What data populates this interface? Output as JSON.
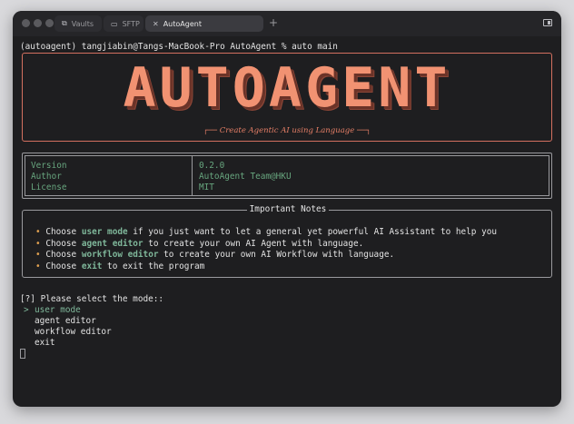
{
  "tabs": [
    {
      "label": "Vaults",
      "icon": "vault-icon"
    },
    {
      "label": "SFTP",
      "icon": "folder-icon"
    },
    {
      "label": "AutoAgent",
      "icon": "close-icon"
    }
  ],
  "prompt": "(autoagent) tangjiabin@Tangs-MacBook-Pro AutoAgent % auto main",
  "banner": {
    "logo": "AUTOAGENT",
    "tagline": "Create Agentic AI using Language"
  },
  "info": {
    "labels": [
      "Version",
      "Author",
      "License"
    ],
    "values": [
      "0.2.0",
      "AutoAgent Team@HKU",
      "MIT"
    ]
  },
  "notes": {
    "title": "Important Notes",
    "items": [
      {
        "pre": "Choose ",
        "kw": "user mode",
        "post": " if you just want to let a general yet powerful AI Assistant to help you"
      },
      {
        "pre": "Choose ",
        "kw": "agent editor",
        "post": " to create your own AI Agent with language."
      },
      {
        "pre": "Choose ",
        "kw": "workflow editor",
        "post": " to create your own AI Workflow with language."
      },
      {
        "pre": "Choose ",
        "kw": "exit",
        "post": " to exit the program"
      }
    ]
  },
  "select": {
    "question": "[?] Please select the mode::",
    "pointer": ">",
    "options": [
      "user mode",
      "agent editor",
      "workflow editor",
      "exit"
    ]
  },
  "colors": {
    "accent": "#f19272",
    "keyword": "#7fb79a",
    "bullet": "#e0a050"
  }
}
